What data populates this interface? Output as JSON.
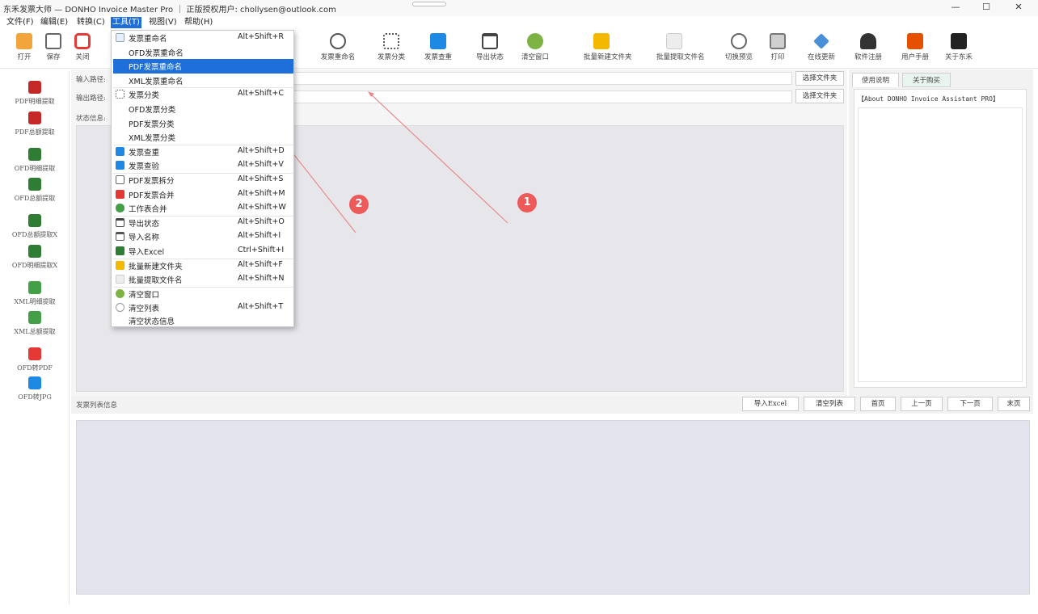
{
  "window": {
    "title": "东禾发票大师 — DONHO Invoice Master Pro ｜ 正版授权用户: chollysen@outlook.com",
    "controls": {
      "minimize": "—",
      "maximize": "☐",
      "close": "✕"
    }
  },
  "menubar": [
    "文件(F)",
    "编辑(E)",
    "转换(C)",
    "工具(T)",
    "视图(V)",
    "帮助(H)"
  ],
  "toolbar": {
    "items": [
      {
        "label": "打开",
        "color": "#f2a53a"
      },
      {
        "label": "保存",
        "color": "#666666"
      },
      {
        "label": "关闭",
        "color": "#e53935"
      },
      {
        "label": "发票重命名",
        "color": "#555555"
      },
      {
        "label": "发票分类",
        "color": "#555555"
      },
      {
        "label": "发票查重",
        "color": "#1e88e5"
      },
      {
        "label": "导出状态",
        "color": "#444444"
      },
      {
        "label": "清空窗口",
        "color": "#7cb342"
      },
      {
        "label": "批量新建文件夹",
        "color": "#f5b800"
      },
      {
        "label": "批量提取文件名",
        "color": "#bbbbbb"
      },
      {
        "label": "切换预览",
        "color": "#666666"
      },
      {
        "label": "打印",
        "color": "#777777"
      },
      {
        "label": "在线更新",
        "color": "#4a90d9"
      },
      {
        "label": "软件注册",
        "color": "#333333"
      },
      {
        "label": "用户手册",
        "color": "#e65100"
      },
      {
        "label": "关于东禾",
        "color": "#222222"
      }
    ]
  },
  "sidebar": {
    "items": [
      {
        "label": "PDF明细提取",
        "color": "#c62828"
      },
      {
        "label": "PDF总额提取",
        "color": "#c62828"
      },
      {
        "label": "OFD明细提取",
        "color": "#2e7d32"
      },
      {
        "label": "OFD总额提取",
        "color": "#2e7d32"
      },
      {
        "label": "OFD总额提取X",
        "color": "#2e7d32"
      },
      {
        "label": "OFD明细提取X",
        "color": "#2e7d32"
      },
      {
        "label": "XML明细提取",
        "color": "#43a047"
      },
      {
        "label": "XML总额提取",
        "color": "#43a047"
      },
      {
        "label": "OFD转PDF",
        "color": "#e53935"
      },
      {
        "label": "OFD转JPG",
        "color": "#1e88e5"
      }
    ]
  },
  "main": {
    "input_path_label": "输入路径:",
    "output_path_label": "输出路径:",
    "input_path_value": "",
    "output_path_value": "",
    "select_folder_label": "选择文件夹",
    "status_info_label": "状态信息:"
  },
  "right_panel": {
    "tabs": [
      "使用说明",
      "关于购买"
    ],
    "about_text": "【About DONHO Invoice Assistant PRO】"
  },
  "list_section": {
    "label": "发票列表信息",
    "buttons": [
      "导入Excel",
      "清空列表",
      "首页",
      "上一页",
      "下一页",
      "末页"
    ]
  },
  "tools_menu": {
    "items": [
      {
        "label": "发票重命名",
        "shortcut": "Alt+Shift+R",
        "icon": "#e8efff"
      },
      {
        "label": "OFD发票重命名",
        "shortcut": "",
        "icon": ""
      },
      {
        "label": "PDF发票重命名",
        "shortcut": "",
        "icon": "",
        "highlighted": true
      },
      {
        "label": "XML发票重命名",
        "shortcut": "",
        "icon": ""
      },
      {
        "label": "发票分类",
        "shortcut": "Alt+Shift+C",
        "icon": "#555555"
      },
      {
        "label": "OFD发票分类",
        "shortcut": "",
        "icon": ""
      },
      {
        "label": "PDF发票分类",
        "shortcut": "",
        "icon": ""
      },
      {
        "label": "XML发票分类",
        "shortcut": "",
        "icon": ""
      },
      {
        "label": "发票查重",
        "shortcut": "Alt+Shift+D",
        "icon": "#1e88e5"
      },
      {
        "label": "发票查验",
        "shortcut": "Alt+Shift+V",
        "icon": "#1e88e5"
      },
      {
        "label": "PDF发票拆分",
        "shortcut": "Alt+Shift+S",
        "icon": "#666666"
      },
      {
        "label": "PDF发票合并",
        "shortcut": "Alt+Shift+M",
        "icon": "#e53935"
      },
      {
        "label": "工作表合并",
        "shortcut": "Alt+Shift+W",
        "icon": "#43a047"
      },
      {
        "label": "导出状态",
        "shortcut": "Alt+Shift+O",
        "icon": "#444444"
      },
      {
        "label": "导入名称",
        "shortcut": "Alt+Shift+I",
        "icon": "#555555"
      },
      {
        "label": "导入Excel",
        "shortcut": "Ctrl+Shift+I",
        "icon": "#2e7d32"
      },
      {
        "label": "批量新建文件夹",
        "shortcut": "Alt+Shift+F",
        "icon": "#f5b800"
      },
      {
        "label": "批量提取文件名",
        "shortcut": "Alt+Shift+N",
        "icon": "#dddddd"
      },
      {
        "label": "清空窗口",
        "shortcut": "",
        "icon": "#7cb342"
      },
      {
        "label": "清空列表",
        "shortcut": "Alt+Shift+T",
        "icon": "#999999"
      },
      {
        "label": "清空状态信息",
        "shortcut": "",
        "icon": ""
      }
    ]
  },
  "annotations": [
    {
      "number": "1",
      "color": "#ec5a5a"
    },
    {
      "number": "2",
      "color": "#ec5a5a"
    }
  ]
}
